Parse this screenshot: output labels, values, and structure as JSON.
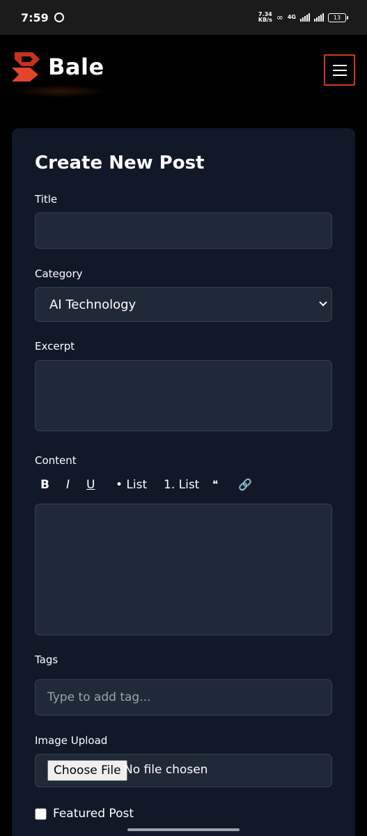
{
  "status_bar": {
    "time": "7:59",
    "net_speed": "7.34\nKB/s",
    "net_type": "4G",
    "battery": "13"
  },
  "brand": {
    "name": "Bale",
    "accent": "#d23a1c"
  },
  "form": {
    "title": "Create New Post",
    "title_label": "Title",
    "title_value": "",
    "category_label": "Category",
    "category_value": "AI Technology",
    "excerpt_label": "Excerpt",
    "excerpt_value": "",
    "content_label": "Content",
    "toolbar": {
      "bold": "B",
      "italic": "I",
      "underline": "U",
      "bullet_list": "• List",
      "numbered_list": "1. List",
      "quote": "❝",
      "link": "🔗"
    },
    "content_value": "",
    "tags_label": "Tags",
    "tags_placeholder": "Type to add tag...",
    "image_label": "Image Upload",
    "choose_file": "Choose File",
    "file_status": "No file chosen",
    "featured_label": "Featured Post"
  }
}
